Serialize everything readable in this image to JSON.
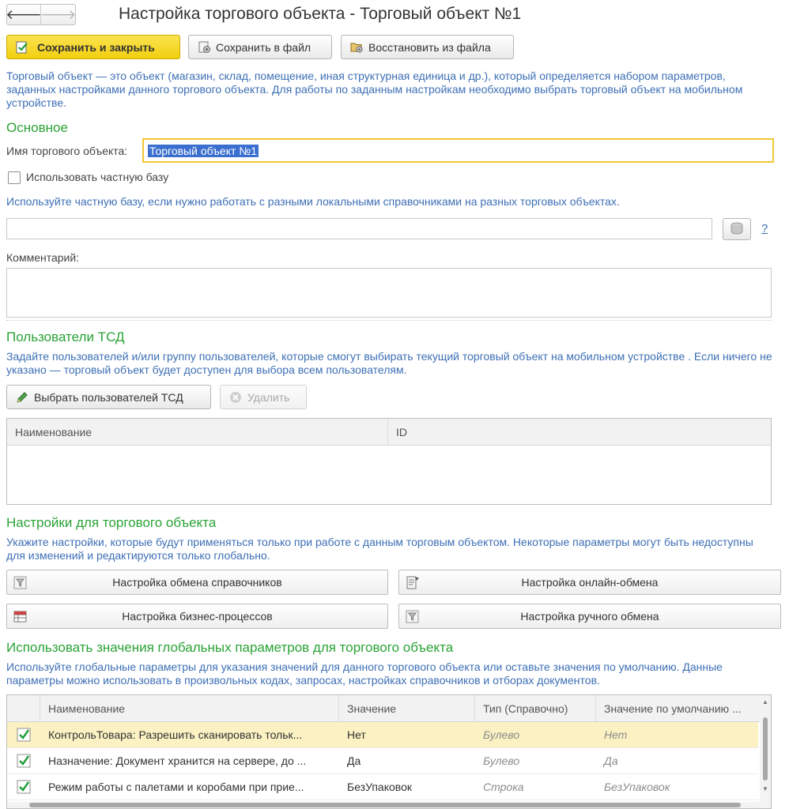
{
  "window": {
    "title": "Настройка торгового объекта - Торговый объект №1",
    "nav_back": "🡐",
    "nav_forward": "🡒"
  },
  "toolbar": {
    "save_close": "Сохранить и закрыть",
    "save_file": "Сохранить в файл",
    "restore_file": "Восстановить из файла"
  },
  "intro_text": "Торговый объект — это объект (магазин, склад, помещение, иная структурная единица и др.), который определяется набором параметров, заданных настройками данного торгового объекта. Для работы по заданным настройкам необходимо выбрать торговый объект на мобильном устройстве.",
  "main": {
    "section_title": "Основное",
    "name_label": "Имя торгового объекта:",
    "name_value": "Торговый объект №1",
    "private_db_label": "Использовать частную базу",
    "private_db_hint": "Используйте частную базу, если нужно работать с разными локальными справочниками на разных торговых объектах.",
    "help_link": "?",
    "comment_label": "Комментарий:"
  },
  "users": {
    "section_title": "Пользователи ТСД",
    "hint": "Задайте пользователей и/или группу пользователей, которые смогут выбирать текущий торговый объект на мобильном устройстве . Если ничего не указано — торговый объект будет доступен для выбора всем пользователям.",
    "select_button": "Выбрать пользователей ТСД",
    "delete_button": "Удалить",
    "columns": [
      "Наименование",
      "ID"
    ]
  },
  "object_settings": {
    "section_title": "Настройки для торгового объекта",
    "hint": "Укажите настройки, которые будут применяться только при работе с данным торговым объектом. Некоторые параметры могут быть недоступны для изменений и редактируются только глобально.",
    "btn_catalog_exchange": "Настройка обмена справочников",
    "btn_online_exchange": "Настройка онлайн-обмена",
    "btn_business_processes": "Настройка бизнес-процессов",
    "btn_manual_exchange": "Настройка ручного обмена"
  },
  "global_params": {
    "section_title": "Использовать значения глобальных параметров для торгового объекта",
    "hint": "Используйте глобальные параметры для указания значений для данного торгового объекта или оставьте значения по умолчанию. Данные параметры можно использовать в произвольных кодах, запросах, настройках справочников и отборах документов.",
    "columns": {
      "name": "Наименование",
      "value": "Значение",
      "type": "Тип (Справочно)",
      "default": "Значение по умолчанию ..."
    },
    "rows": [
      {
        "checked": true,
        "name": "КонтрольТовара: Разрешить сканировать тольк...",
        "value": "Нет",
        "type": "Булево",
        "default": "Нет"
      },
      {
        "checked": true,
        "name": "Назначение: Документ хранится на сервере, до ...",
        "value": "Да",
        "type": "Булево",
        "default": "Да"
      },
      {
        "checked": true,
        "name": "Режим работы с палетами и коробами при прие...",
        "value": "БезУпаковок",
        "type": "Строка",
        "default": "БезУпаковок"
      }
    ]
  },
  "colors": {
    "accent_yellow": "#f2cf10",
    "section_green": "#2aa336",
    "info_blue": "#3d6fb5",
    "check_green": "#1f9d3a",
    "row_selected": "#fbf1c2"
  }
}
